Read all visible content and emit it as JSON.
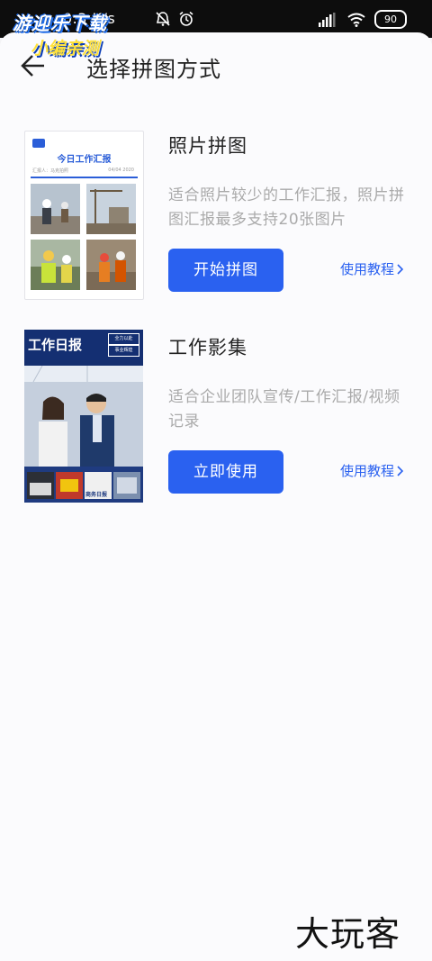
{
  "status_bar": {
    "speed": "0.3 K/s",
    "battery": "90"
  },
  "watermark": {
    "line1": "游迎乐下载",
    "line2": "小编亲测",
    "bottom": "大玩客"
  },
  "header": {
    "title": "选择拼图方式"
  },
  "cards": [
    {
      "title": "照片拼图",
      "description": "适合照片较少的工作汇报，照片拼图汇报最多支持20张图片",
      "button": "开始拼图",
      "tutorial": "使用教程",
      "thumb": {
        "heading": "今日工作汇报",
        "reporter": "汇报人：马克拍照",
        "date": "04/04 2020"
      }
    },
    {
      "title": "工作影集",
      "description": "适合企业团队宣传/工作汇报/视频记录",
      "button": "立即使用",
      "tutorial": "使用教程",
      "thumb": {
        "heading": "工作日报",
        "tag1": "全力以赴",
        "tag2": "事业辉煌",
        "mini_labels": [
          "",
          "",
          "商务日报",
          ""
        ]
      }
    }
  ],
  "colors": {
    "accent": "#2a61f0",
    "statusbar": "#0d0d0d"
  }
}
